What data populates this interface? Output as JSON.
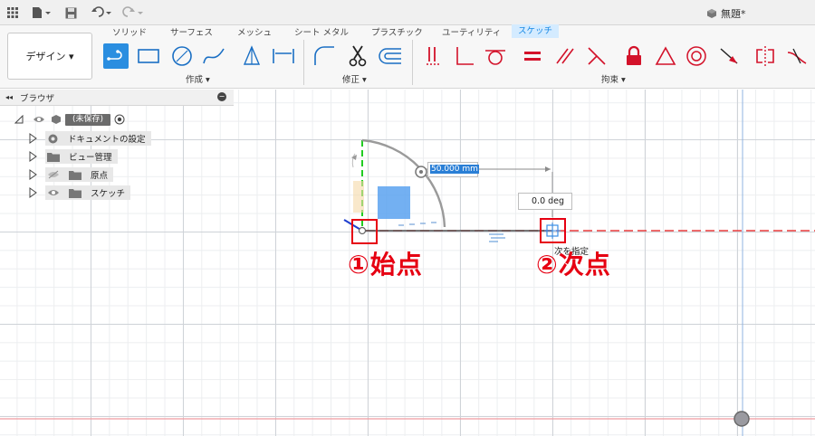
{
  "titlebar": {
    "document_title": "無題*"
  },
  "ribbon": {
    "workspace_label": "デザイン ▾",
    "tabs": [
      {
        "label": "ソリッド"
      },
      {
        "label": "サーフェス"
      },
      {
        "label": "メッシュ"
      },
      {
        "label": "シート メタル"
      },
      {
        "label": "プラスチック"
      },
      {
        "label": "ユーティリティ"
      },
      {
        "label": "スケッチ",
        "active": true
      }
    ],
    "groups": {
      "create": "作成 ▾",
      "modify": "修正 ▾",
      "constraints": "拘束 ▾"
    }
  },
  "browser": {
    "title": "ブラウザ",
    "root": "(未保存)",
    "items": [
      {
        "label": "ドキュメントの設定",
        "icon": "gear-icon"
      },
      {
        "label": "ビュー管理",
        "icon": "folder-icon"
      },
      {
        "label": "原点",
        "icon": "folder-icon"
      },
      {
        "label": "スケッチ",
        "icon": "folder-icon"
      }
    ]
  },
  "sketch": {
    "length_value": "50.000 mm",
    "angle_value": "0.0 deg",
    "tooltip": "次を指定"
  },
  "annotations": {
    "start_point": "①始点",
    "next_point": "②次点"
  },
  "colors": {
    "accent": "#1a8ae5",
    "marker": "#e60012",
    "axis_green": "#22cc22",
    "axis_red": "#e83a3a"
  }
}
